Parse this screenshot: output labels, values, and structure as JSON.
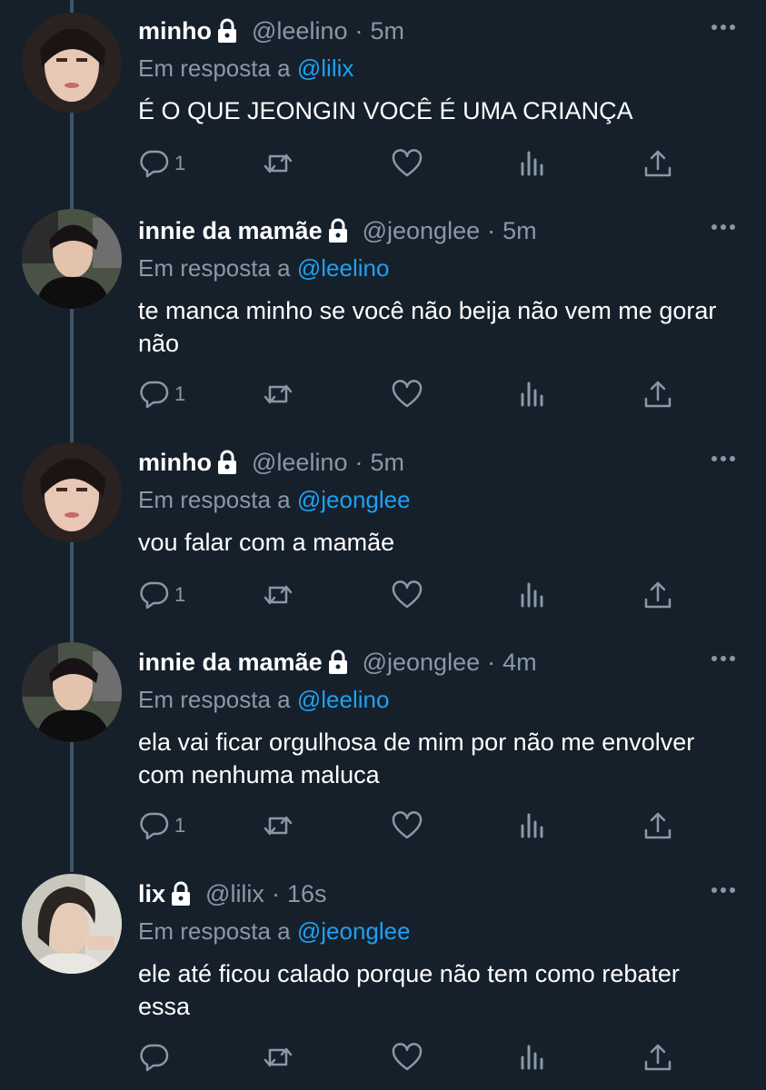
{
  "colors": {
    "background": "#15202b",
    "muted": "#8899a6",
    "link": "#1da1f2",
    "thread_line": "#3d5466"
  },
  "tweets": [
    {
      "name": "minho",
      "handle": "@leelino",
      "dot": "·",
      "time": "5m",
      "reply_prefix": "Em resposta a",
      "reply_to": "@lilix",
      "text": "É O QUE JEONGIN VOCÊ É UMA CRIANÇA",
      "reply_count": "1",
      "avatar": "minho-avatar"
    },
    {
      "name": "innie da mamãe",
      "handle": "@jeonglee",
      "dot": "·",
      "time": "5m",
      "reply_prefix": "Em resposta a",
      "reply_to": "@leelino",
      "text": "te manca minho se você não beija não vem me gorar não",
      "reply_count": "1",
      "avatar": "innie-avatar"
    },
    {
      "name": "minho",
      "handle": "@leelino",
      "dot": "·",
      "time": "5m",
      "reply_prefix": "Em resposta a",
      "reply_to": "@jeonglee",
      "text": "vou falar com a mamãe",
      "reply_count": "1",
      "avatar": "minho-avatar"
    },
    {
      "name": "innie da mamãe",
      "handle": "@jeonglee",
      "dot": "·",
      "time": "4m",
      "reply_prefix": "Em resposta a",
      "reply_to": "@leelino",
      "text": "ela vai ficar orgulhosa de mim por não me envolver com nenhuma maluca",
      "reply_count": "1",
      "avatar": "innie-avatar"
    },
    {
      "name": "lix",
      "handle": "@lilix",
      "dot": "·",
      "time": "16s",
      "reply_prefix": "Em resposta a",
      "reply_to": "@jeonglee",
      "text": "ele até ficou calado porque não tem como rebater essa",
      "reply_count": "",
      "avatar": "lix-avatar"
    }
  ]
}
